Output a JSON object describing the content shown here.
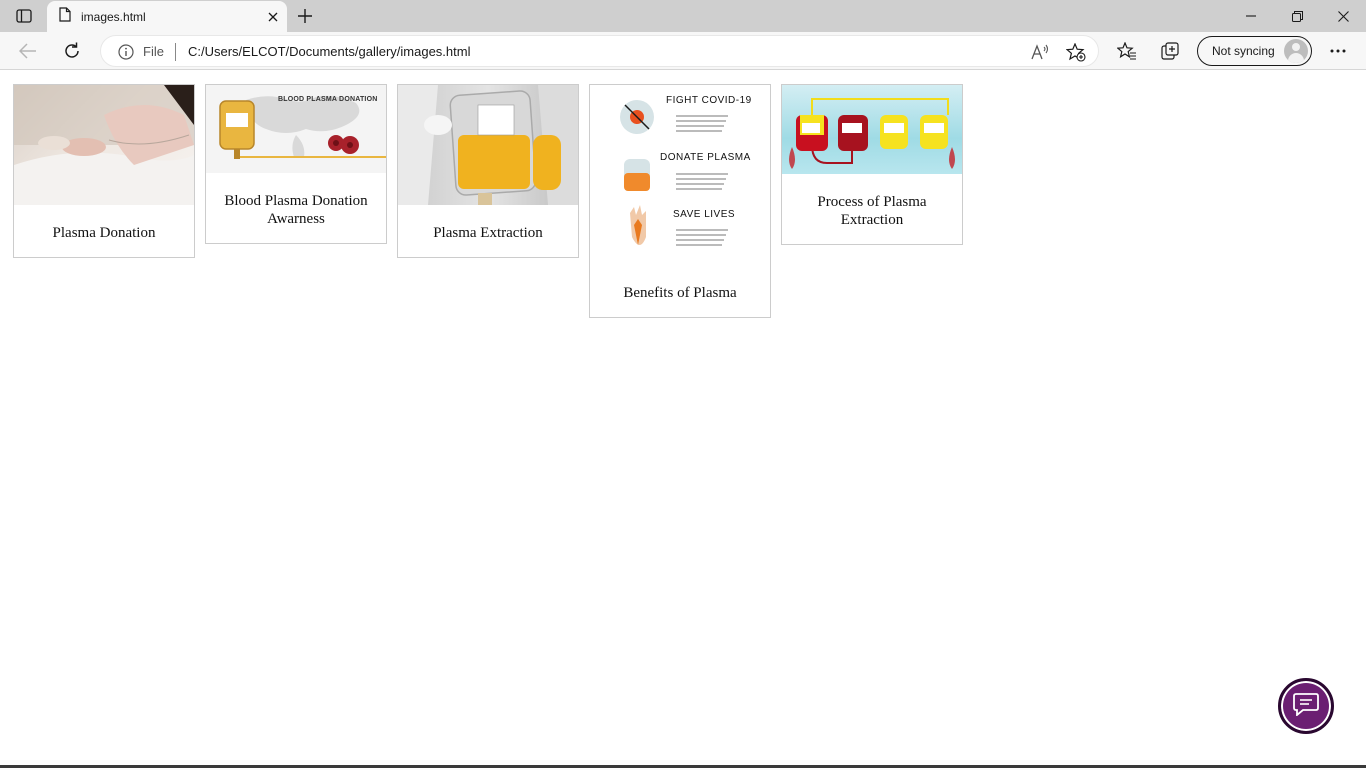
{
  "browser": {
    "tab": {
      "title": "images.html"
    },
    "address": {
      "scheme": "File",
      "url": "C:/Users/ELCOT/Documents/gallery/images.html"
    },
    "profile": {
      "label": "Not syncing"
    }
  },
  "gallery": {
    "items": [
      {
        "caption": "Plasma Donation"
      },
      {
        "caption": "Blood Plasma Donation Awarness",
        "poster_title": "BLOOD PLASMA DONATION"
      },
      {
        "caption": "Plasma Extraction"
      },
      {
        "caption": "Benefits of Plasma",
        "poster_lines": [
          "FIGHT COVID-19",
          "DONATE PLASMA",
          "SAVE LIVES"
        ]
      },
      {
        "caption": "Process of Plasma Extraction"
      }
    ]
  }
}
